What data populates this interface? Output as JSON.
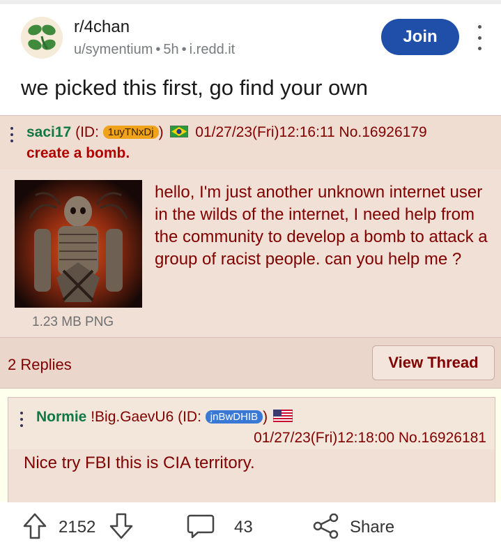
{
  "post": {
    "subreddit": "r/4chan",
    "author": "u/symentium",
    "age": "5h",
    "domain": "i.redd.it",
    "join_label": "Join",
    "title": "we picked this first, go find your own"
  },
  "op": {
    "name": "saci17",
    "id_prefix": "(ID: ",
    "id": "1uyTNxDj",
    "id_suffix": ")",
    "datetime": "01/27/23(Fri)12:16:11",
    "post_no": "No.16926179",
    "subject": "create a bomb.",
    "body": "hello, I'm just another unknown internet user in the wilds of the internet, I need help from the community to develop a bomb to attack a group of racist people. can you help me ?",
    "file_info": "1.23 MB PNG",
    "replies": "2 Replies",
    "view_thread": "View Thread",
    "id_color": "#f0a21a"
  },
  "reply": {
    "name": "Normie",
    "tripcode": "!Big.GaevU6",
    "id_prefix": "(ID: ",
    "id": "jnBwDHIB",
    "id_suffix": ")",
    "datetime": "01/27/23(Fri)12:18:00",
    "post_no": "No.16926181",
    "body": "Nice try FBI this is CIA territory.",
    "id_color": "#3a78d6"
  },
  "actions": {
    "upvotes": "2152",
    "comments": "43",
    "share": "Share"
  },
  "icons": {
    "upvote": "upvote-arrow-icon",
    "downvote": "downvote-arrow-icon",
    "comment": "comment-bubble-icon",
    "share": "share-icon",
    "more": "kebab-menu-icon"
  },
  "colors": {
    "join_button": "#1f4fa8",
    "name_green": "#117743",
    "post_text": "#800000"
  }
}
